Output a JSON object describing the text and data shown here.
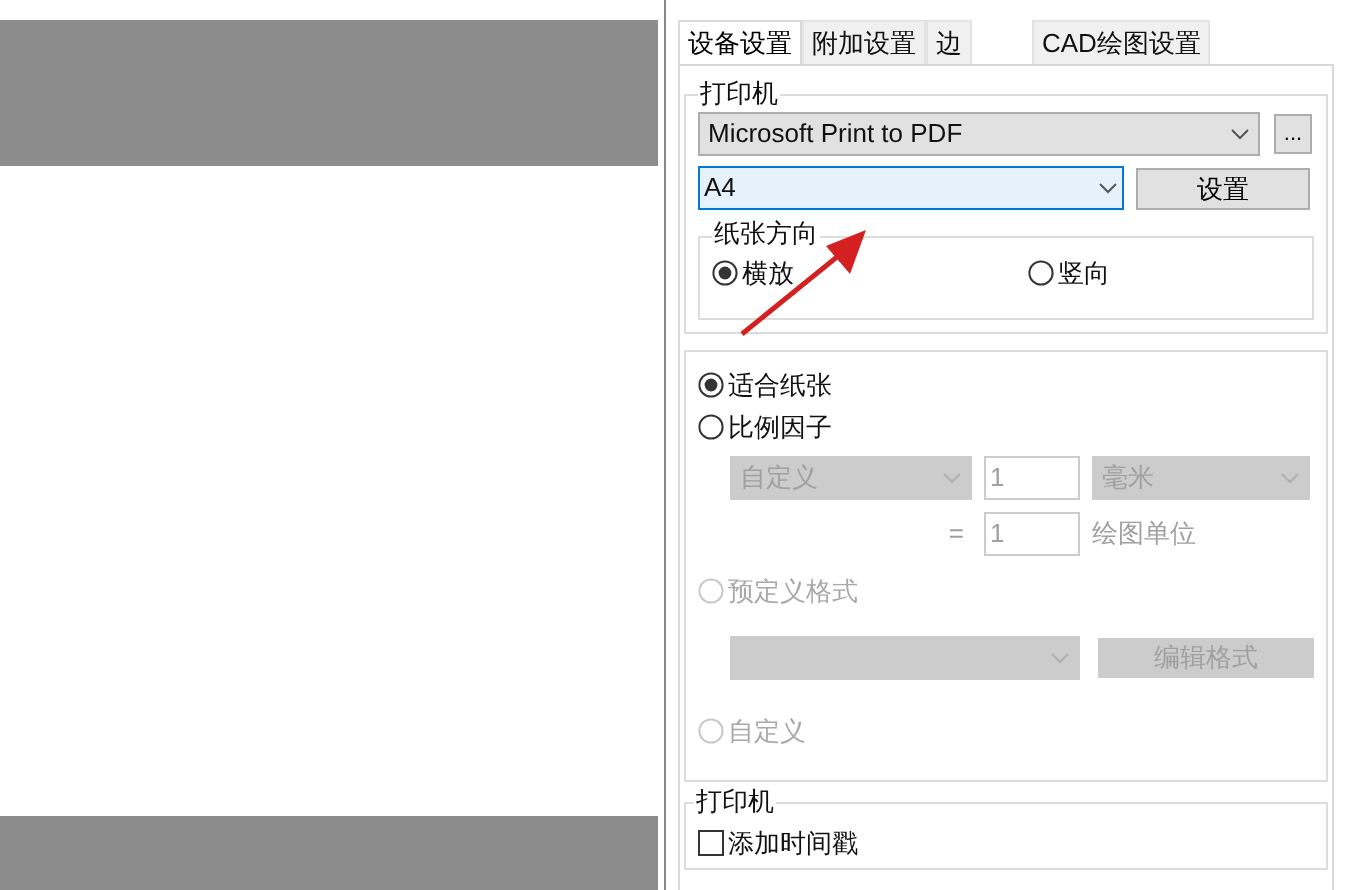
{
  "tabs": [
    {
      "label": "设备设置",
      "selected": true
    },
    {
      "label": "附加设置",
      "selected": false
    },
    {
      "label": "边",
      "selected": false
    },
    {
      "label": "CAD绘图设置",
      "selected": false
    }
  ],
  "printer_group": {
    "title": "打印机",
    "printer": "Microsoft Print to PDF",
    "more_button": "...",
    "paper": "A4",
    "settings_button": "设置"
  },
  "orientation": {
    "title": "纸张方向",
    "options": [
      {
        "label": "横放",
        "selected": true
      },
      {
        "label": "竖向",
        "selected": false
      }
    ]
  },
  "scale_options": [
    {
      "label": "适合纸张",
      "selected": true,
      "disabled": false
    },
    {
      "label": "比例因子",
      "selected": false,
      "disabled": false
    },
    {
      "label": "预定义格式",
      "selected": false,
      "disabled": true
    },
    {
      "label": "自定义",
      "selected": false,
      "disabled": true
    }
  ],
  "scale": {
    "unit_preset": "自定义",
    "value1": "1",
    "unit": "毫米",
    "equals": "=",
    "value2": "1",
    "drawing_unit": "绘图单位",
    "disabled": true
  },
  "edit_format_button": "编辑格式",
  "bottom_group": {
    "title": "打印机",
    "timestamp": {
      "label": "添加时间戳",
      "checked": false
    }
  }
}
